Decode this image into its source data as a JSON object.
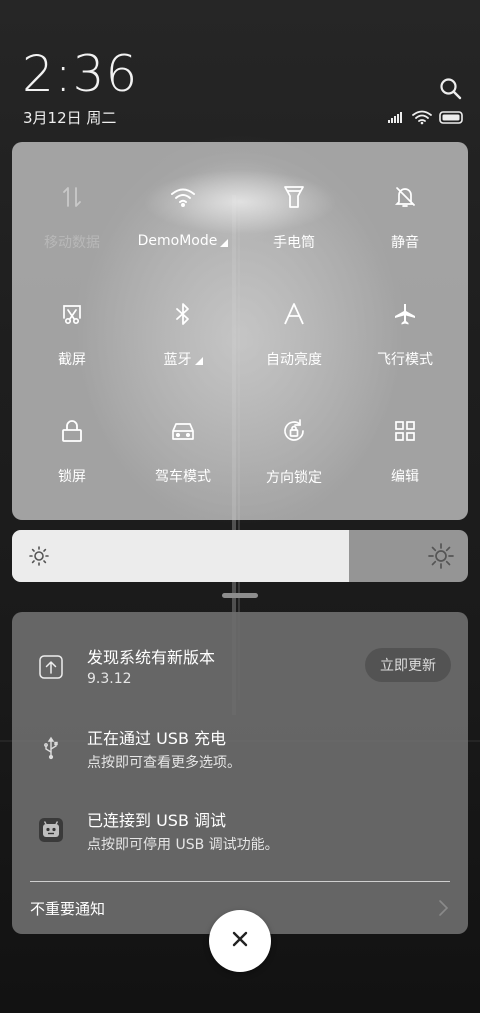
{
  "status": {
    "time": "2:36",
    "date": "3月12日 周二",
    "icons": [
      "search-icon",
      "signal-icon",
      "wifi-icon",
      "battery-icon"
    ]
  },
  "quick_settings": {
    "tiles": [
      {
        "label": "移动数据",
        "icon": "mobile-data-icon",
        "active": false
      },
      {
        "label": "DemoMode",
        "icon": "wifi-icon",
        "active": true,
        "expandable": true
      },
      {
        "label": "手电筒",
        "icon": "flashlight-icon",
        "active": true
      },
      {
        "label": "静音",
        "icon": "mute-bell-icon",
        "active": true
      },
      {
        "label": "截屏",
        "icon": "screenshot-icon",
        "active": true
      },
      {
        "label": "蓝牙",
        "icon": "bluetooth-icon",
        "active": true,
        "expandable": true
      },
      {
        "label": "自动亮度",
        "icon": "auto-brightness-icon",
        "active": true
      },
      {
        "label": "飞行模式",
        "icon": "airplane-icon",
        "active": true
      },
      {
        "label": "锁屏",
        "icon": "lock-icon",
        "active": true
      },
      {
        "label": "驾车模式",
        "icon": "car-icon",
        "active": true
      },
      {
        "label": "方向锁定",
        "icon": "rotation-lock-icon",
        "active": true
      },
      {
        "label": "编辑",
        "icon": "edit-grid-icon",
        "active": true
      }
    ]
  },
  "brightness": {
    "level": 0.74,
    "low_icon": "brightness-low-icon",
    "high_icon": "brightness-high-icon"
  },
  "notifications": {
    "items": [
      {
        "title": "发现系统有新版本",
        "subtitle": "9.3.12",
        "icon": "system-update-icon",
        "action": "立即更新"
      },
      {
        "title": "正在通过 USB 充电",
        "subtitle": "点按即可查看更多选项。",
        "icon": "usb-icon"
      },
      {
        "title": "已连接到 USB 调试",
        "subtitle": "点按即可停用 USB 调试功能。",
        "icon": "usb-debug-icon"
      }
    ],
    "unimportant_label": "不重要通知"
  },
  "colors": {
    "panel": "#c8c8c8",
    "notification_panel": "#6c6c6c",
    "brightness_fill": "#ececec"
  }
}
